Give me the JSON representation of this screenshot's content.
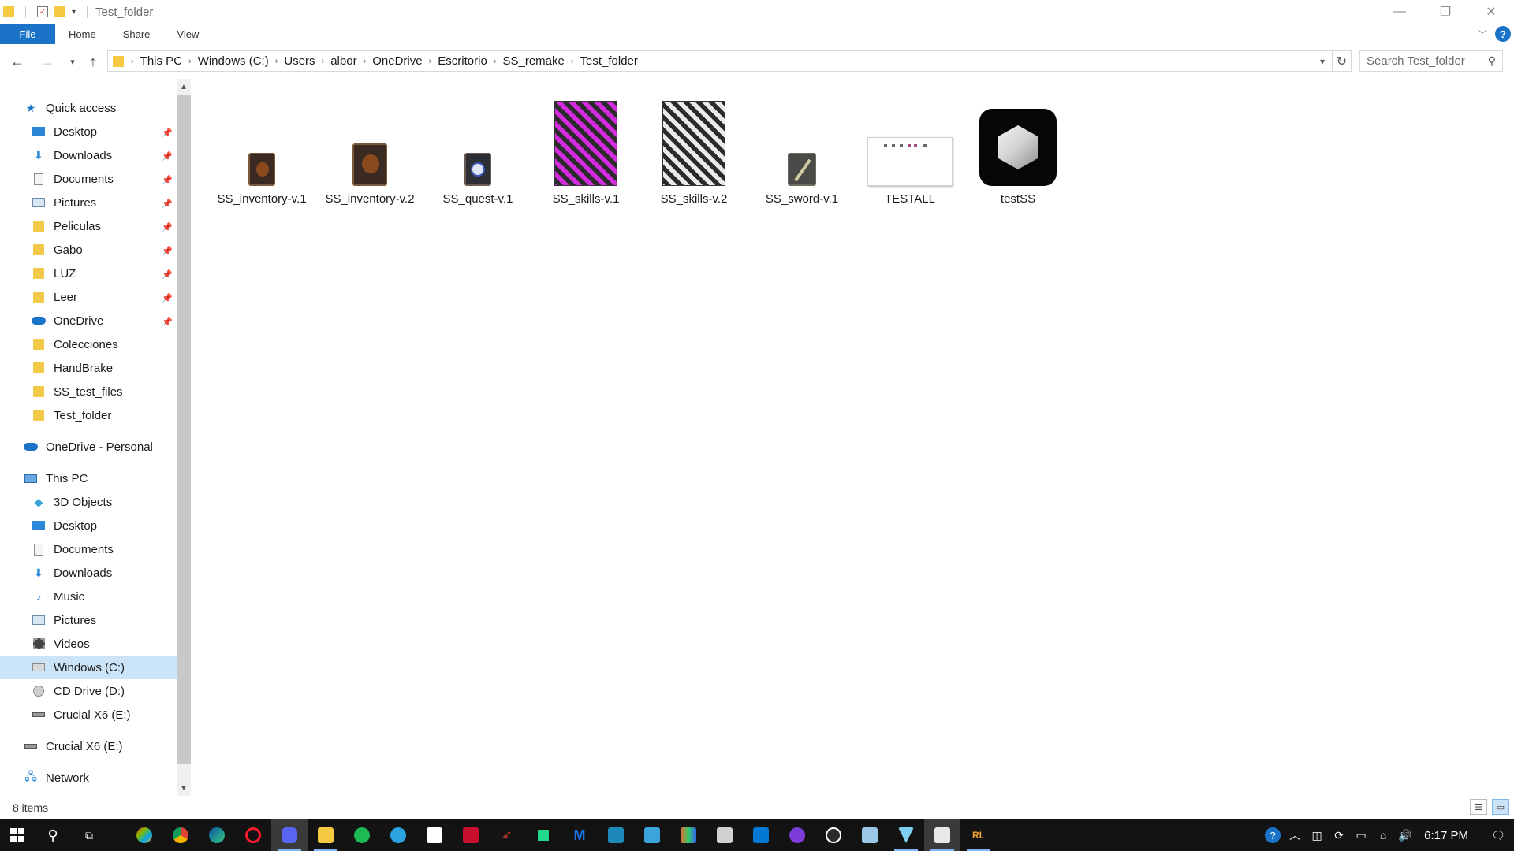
{
  "window": {
    "title": "Test_folder",
    "minimize": "—",
    "restore": "❐",
    "close": "✕"
  },
  "ribbon": {
    "tabs": [
      "File",
      "Home",
      "Share",
      "View"
    ],
    "help": "?"
  },
  "address": {
    "crumbs": [
      "This PC",
      "Windows (C:)",
      "Users",
      "albor",
      "OneDrive",
      "Escritorio",
      "SS_remake",
      "Test_folder"
    ],
    "search_placeholder": "Search Test_folder"
  },
  "navigation": {
    "quick_access_label": "Quick access",
    "quick_access_items": [
      {
        "label": "Desktop",
        "icon": "desktop-icon",
        "pinned": true
      },
      {
        "label": "Downloads",
        "icon": "downloads-icon",
        "pinned": true
      },
      {
        "label": "Documents",
        "icon": "documents-icon",
        "pinned": true
      },
      {
        "label": "Pictures",
        "icon": "pictures-icon",
        "pinned": true
      },
      {
        "label": "Peliculas",
        "icon": "folder-icon",
        "pinned": true
      },
      {
        "label": "Gabo",
        "icon": "folder-icon",
        "pinned": true
      },
      {
        "label": "LUZ",
        "icon": "folder-icon",
        "pinned": true
      },
      {
        "label": "Leer",
        "icon": "folder-icon",
        "pinned": true
      },
      {
        "label": "OneDrive",
        "icon": "onedrive-icon",
        "pinned": true
      },
      {
        "label": "Colecciones",
        "icon": "folder-icon",
        "pinned": false
      },
      {
        "label": "HandBrake",
        "icon": "folder-icon",
        "pinned": false
      },
      {
        "label": "SS_test_files",
        "icon": "folder-icon",
        "pinned": false
      },
      {
        "label": "Test_folder",
        "icon": "folder-icon",
        "pinned": false
      }
    ],
    "onedrive_personal": "OneDrive - Personal",
    "this_pc_label": "This PC",
    "this_pc_items": [
      {
        "label": "3D Objects",
        "icon": "3d-objects-icon"
      },
      {
        "label": "Desktop",
        "icon": "desktop-icon"
      },
      {
        "label": "Documents",
        "icon": "documents-icon"
      },
      {
        "label": "Downloads",
        "icon": "downloads-icon"
      },
      {
        "label": "Music",
        "icon": "music-icon"
      },
      {
        "label": "Pictures",
        "icon": "pictures-icon"
      },
      {
        "label": "Videos",
        "icon": "videos-icon"
      },
      {
        "label": "Windows (C:)",
        "icon": "drive-c-icon",
        "selected": true
      },
      {
        "label": "CD Drive (D:)",
        "icon": "cd-drive-icon"
      },
      {
        "label": "Crucial X6 (E:)",
        "icon": "usb-drive-icon"
      }
    ],
    "crucial_root": "Crucial X6 (E:)",
    "network": "Network"
  },
  "files": [
    {
      "name": "SS_inventory-v.1",
      "thumb": "inventory-small"
    },
    {
      "name": "SS_inventory-v.2",
      "thumb": "inventory-large"
    },
    {
      "name": "SS_quest-v.1",
      "thumb": "quest"
    },
    {
      "name": "SS_skills-v.1",
      "thumb": "skills-magenta"
    },
    {
      "name": "SS_skills-v.2",
      "thumb": "skills-white"
    },
    {
      "name": "SS_sword-v.1",
      "thumb": "sword"
    },
    {
      "name": "TESTALL",
      "thumb": "screenshot"
    },
    {
      "name": "testSS",
      "thumb": "unity-logo"
    }
  ],
  "status": {
    "item_count": "8 items"
  },
  "taskbar": {
    "clock": "6:17 PM",
    "apps": [
      "start-icon",
      "search-icon",
      "task-view-icon",
      "app-icon",
      "chrome-icon",
      "edge-icon",
      "opera-icon",
      "discord-icon",
      "file-explorer-icon",
      "spotify-icon",
      "telegram-icon",
      "store-icon",
      "app-icon",
      "app-icon",
      "pycharm-icon",
      "app-icon",
      "app-icon",
      "app-icon",
      "app-icon",
      "app-icon",
      "vscode-icon",
      "app-icon",
      "app-icon",
      "app-icon",
      "app-icon",
      "app-icon",
      "app-icon"
    ]
  }
}
